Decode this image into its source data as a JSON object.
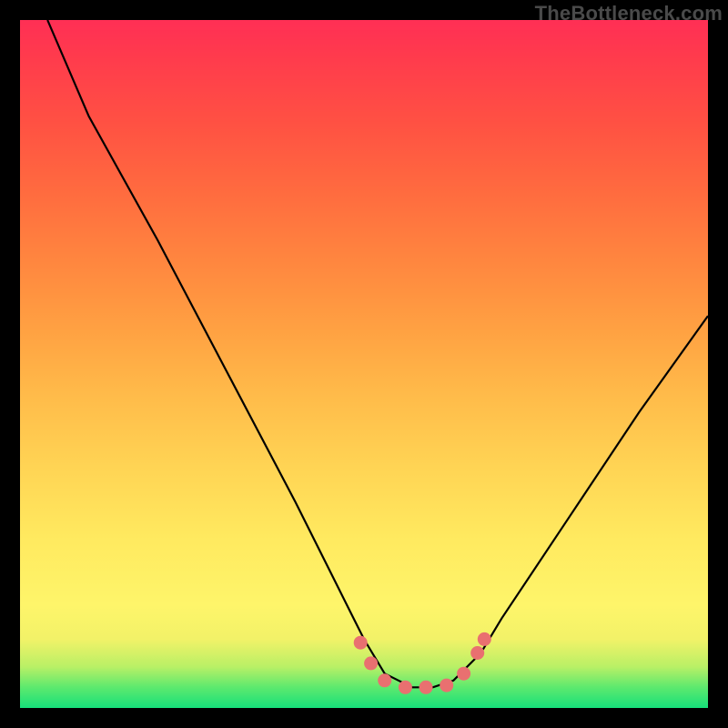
{
  "watermark": "TheBottleneck.com",
  "chart_data": {
    "type": "line",
    "title": "",
    "xlabel": "",
    "ylabel": "",
    "xlim": [
      0,
      100
    ],
    "ylim": [
      0,
      100
    ],
    "grid": false,
    "legend": false,
    "note": "Axes have no numeric tick labels in the image; x/y values below are estimated relative positions (0–100) read from the plot geometry.",
    "series": [
      {
        "name": "bottleneck-curve",
        "x": [
          4,
          10,
          20,
          30,
          40,
          48,
          50,
          53,
          57,
          60,
          63,
          67,
          70,
          80,
          90,
          100
        ],
        "y": [
          100,
          86,
          68,
          49,
          30,
          14,
          10,
          5,
          3,
          3,
          4,
          8,
          13,
          28,
          43,
          57
        ]
      }
    ],
    "markers": [
      {
        "x": 49.5,
        "y": 9.5
      },
      {
        "x": 51.0,
        "y": 6.5
      },
      {
        "x": 53.0,
        "y": 4.0
      },
      {
        "x": 56.0,
        "y": 3.0
      },
      {
        "x": 59.0,
        "y": 3.0
      },
      {
        "x": 62.0,
        "y": 3.3
      },
      {
        "x": 64.5,
        "y": 5.0
      },
      {
        "x": 66.5,
        "y": 8.0
      },
      {
        "x": 67.5,
        "y": 10.0
      }
    ],
    "gradient_stops": [
      {
        "pos": 0,
        "color": "#16e07a"
      },
      {
        "pos": 0.1,
        "color": "#f2f268"
      },
      {
        "pos": 0.5,
        "color": "#ffbc4a"
      },
      {
        "pos": 1.0,
        "color": "#ff2f55"
      }
    ]
  }
}
